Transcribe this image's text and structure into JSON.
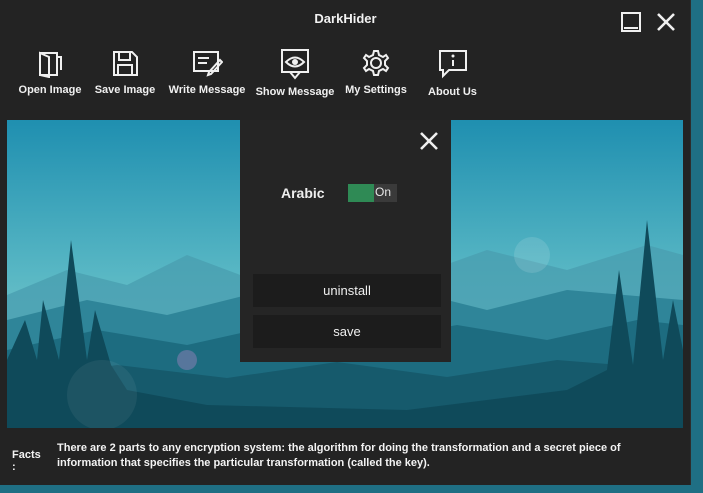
{
  "window": {
    "title": "DarkHider"
  },
  "title_buttons": {
    "minimize_icon": "minimize-icon",
    "close_icon": "close-icon"
  },
  "toolbar": {
    "items": [
      {
        "label": "Open Image",
        "icon": "open-image-icon"
      },
      {
        "label": "Save Image",
        "icon": "save-icon"
      },
      {
        "label": "Write Message",
        "icon": "write-message-icon"
      },
      {
        "label": "Show Message",
        "icon": "show-message-icon"
      },
      {
        "label": "My Settings",
        "icon": "gear-icon"
      },
      {
        "label": "About Us",
        "icon": "info-icon"
      }
    ]
  },
  "settings_dialog": {
    "language_label": "Arabic",
    "language_toggle_state": "On",
    "uninstall_label": "uninstall",
    "save_label": "save",
    "colors": {
      "toggle_on": "#2f8a55",
      "panel": "#252525"
    }
  },
  "facts": {
    "label": "Facts :",
    "text": "There are 2 parts to any encryption system: the algorithm for doing the transformation and a secret piece of information that specifies the particular transformation (called the key)."
  }
}
